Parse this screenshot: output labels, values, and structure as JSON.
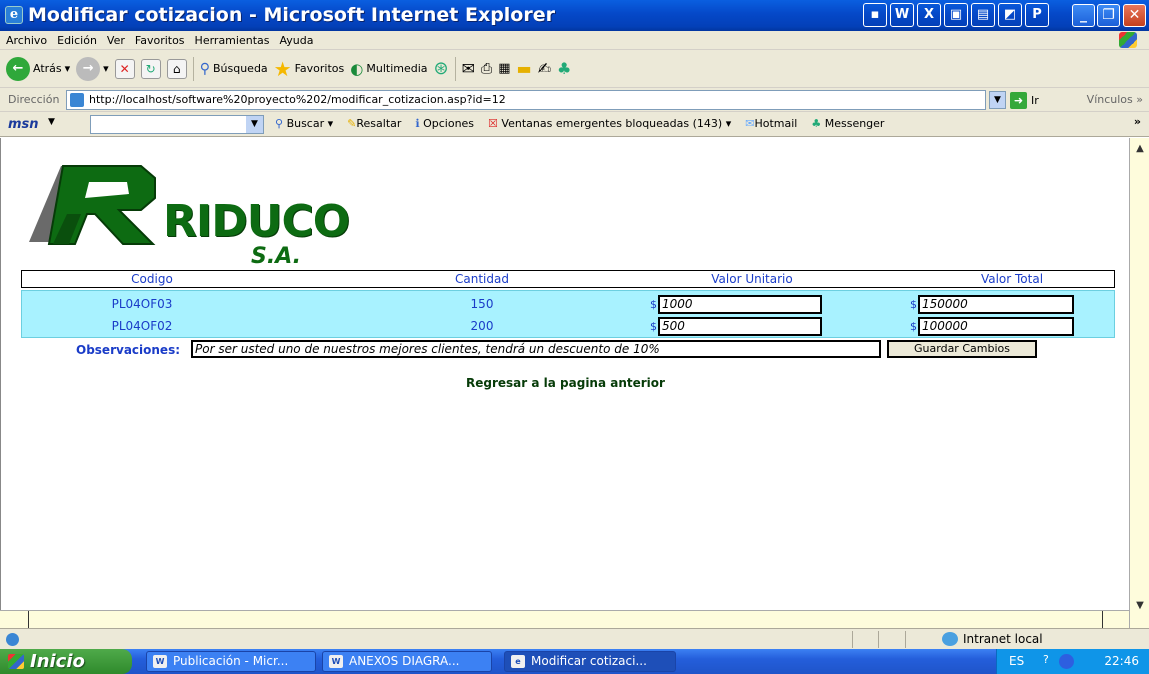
{
  "window": {
    "title": "Modificar cotizacion - Microsoft Internet Explorer"
  },
  "menu": [
    "Archivo",
    "Edición",
    "Ver",
    "Favoritos",
    "Herramientas",
    "Ayuda"
  ],
  "toolbar": {
    "back": "Atrás",
    "search": "Búsqueda",
    "favorites": "Favoritos",
    "media": "Multimedia"
  },
  "address": {
    "label": "Dirección",
    "url": "http://localhost/software%20proyecto%202/modificar_cotizacion.asp?id=12",
    "go": "Ir",
    "links": "Vínculos"
  },
  "msn": {
    "logo": "msn",
    "search_button": "Buscar",
    "highlight": "Resaltar",
    "options": "Opciones",
    "popups": "Ventanas emergentes bloqueadas (143)",
    "hotmail": "Hotmail",
    "messenger": "Messenger"
  },
  "brand": {
    "name": "RIDUCO",
    "suffix": "S.A."
  },
  "table": {
    "headers": [
      "Codigo",
      "Cantidad",
      "Valor Unitario",
      "Valor Total"
    ],
    "currency": "$",
    "rows": [
      {
        "code": "PL04OF03",
        "qty": "150",
        "unit": "1000",
        "total": "150000"
      },
      {
        "code": "PL04OF02",
        "qty": "200",
        "unit": "500",
        "total": "100000"
      }
    ]
  },
  "observations": {
    "label": "Observaciones:",
    "value": "Por ser usted uno de nuestros mejores clientes, tendrá un descuento de 10%"
  },
  "save_button": "Guardar Cambios",
  "back_link": "Regresar a la pagina anterior",
  "status": {
    "zone": "Intranet local"
  },
  "taskbar": {
    "start": "Inicio",
    "tasks": [
      "Publicación - Micr...",
      "ANEXOS DIAGRA...",
      "Modificar cotizaci..."
    ],
    "lang": "ES",
    "clock": "22:46"
  },
  "colors": {
    "brand_green": "#0d6b12",
    "row_bg": "#a8f2ff",
    "link_blue": "#1a3cc8"
  }
}
